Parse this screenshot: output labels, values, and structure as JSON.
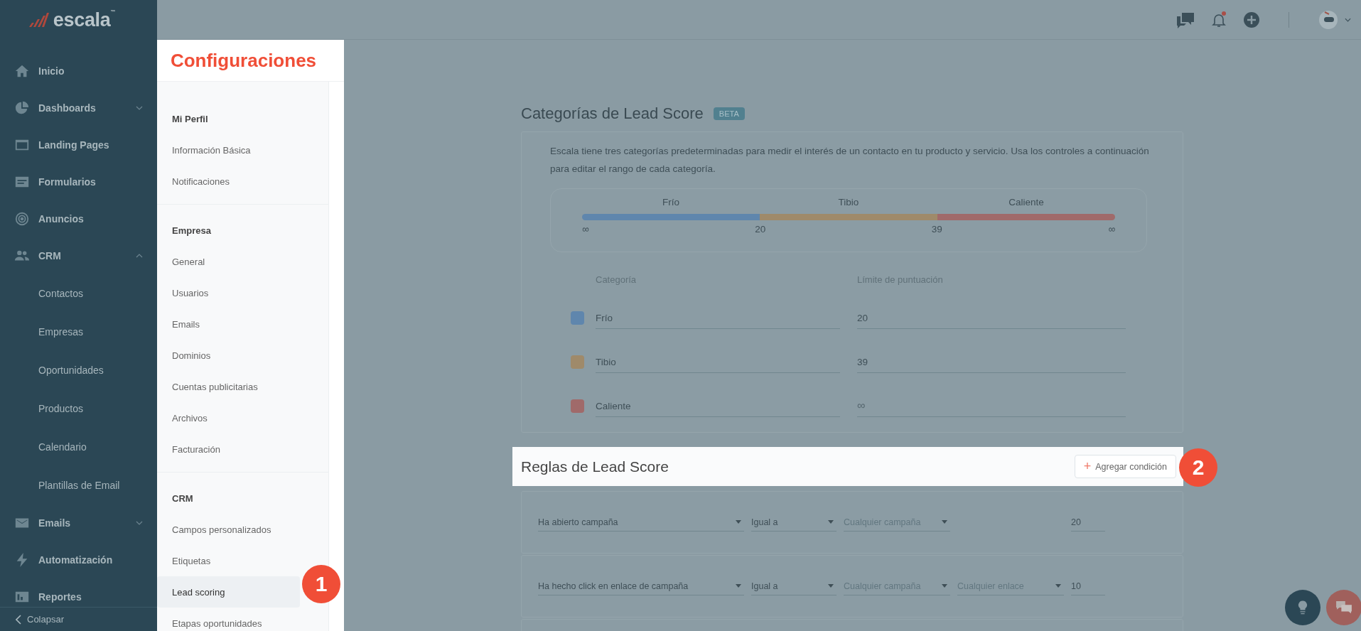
{
  "logo": {
    "text": "escala",
    "mark": "™"
  },
  "sidebar": {
    "items": [
      {
        "label": "Inicio",
        "kind": "section"
      },
      {
        "label": "Dashboards",
        "kind": "section",
        "expanded": false
      },
      {
        "label": "Landing Pages",
        "kind": "section"
      },
      {
        "label": "Formularios",
        "kind": "section"
      },
      {
        "label": "Anuncios",
        "kind": "section"
      },
      {
        "label": "CRM",
        "kind": "section",
        "expanded": true
      },
      {
        "label": "Contactos",
        "kind": "subitem"
      },
      {
        "label": "Empresas",
        "kind": "subitem"
      },
      {
        "label": "Oportunidades",
        "kind": "subitem"
      },
      {
        "label": "Productos",
        "kind": "subitem"
      },
      {
        "label": "Calendario",
        "kind": "subitem"
      },
      {
        "label": "Plantillas de Email",
        "kind": "subitem"
      },
      {
        "label": "Emails",
        "kind": "section",
        "expanded": false
      },
      {
        "label": "Automatización",
        "kind": "section"
      },
      {
        "label": "Reportes",
        "kind": "section"
      }
    ],
    "collapse": "Colapsar"
  },
  "topbar": {
    "notification_dot": true
  },
  "settings": {
    "title": "Configuraciones",
    "groups": [
      {
        "heading": "Mi Perfil",
        "items": [
          {
            "label": "Información Básica",
            "selected": false
          },
          {
            "label": "Notificaciones",
            "selected": false
          }
        ]
      },
      {
        "heading": "Empresa",
        "items": [
          {
            "label": "General",
            "selected": false
          },
          {
            "label": "Usuarios",
            "selected": false
          },
          {
            "label": "Emails",
            "selected": false
          },
          {
            "label": "Dominios",
            "selected": false
          },
          {
            "label": "Cuentas publicitarias",
            "selected": false
          },
          {
            "label": "Archivos",
            "selected": false
          },
          {
            "label": "Facturación",
            "selected": false
          }
        ]
      },
      {
        "heading": "CRM",
        "items": [
          {
            "label": "Campos personalizados",
            "selected": false
          },
          {
            "label": "Etiquetas",
            "selected": false
          },
          {
            "label": "Lead scoring",
            "selected": true
          },
          {
            "label": "Etapas oportunidades",
            "selected": false
          }
        ]
      }
    ]
  },
  "categories": {
    "title": "Categorías de Lead Score",
    "badge": "BETA",
    "description": "Escala tiene tres categorías predeterminadas para medir el interés de un contacto en tu producto y servicio. Usa los controles a continuación para editar el rango de cada categoría.",
    "scale": {
      "segments": [
        {
          "label": "Frío",
          "color": "#5f86ad"
        },
        {
          "label": "Tibio",
          "color": "#9f8a6a"
        },
        {
          "label": "Caliente",
          "color": "#a06a6a"
        }
      ],
      "ticks": [
        "∞",
        "20",
        "39",
        "∞"
      ]
    },
    "columns": [
      "Categoría",
      "Límite de puntuación"
    ],
    "rows": [
      {
        "color": "#5f86ad",
        "name": "Frío",
        "limit": {
          "value": "20"
        }
      },
      {
        "color": "#9f8a6a",
        "name": "Tibio",
        "limit": {
          "value": "39"
        }
      },
      {
        "color": "#a06a6a",
        "name": "Caliente",
        "limit": {
          "placeholder": "∞"
        }
      }
    ]
  },
  "rules": {
    "title": "Reglas de Lead Score",
    "add_button": "Agregar condición",
    "add_icon": "+",
    "rows": [
      {
        "condition": "Ha abierto campaña",
        "operator": "Igual a",
        "campaign": "Cualquier campaña",
        "points": "20"
      },
      {
        "condition": "Ha hecho click en enlace de campaña",
        "operator": "Igual a",
        "campaign": "Cualquier campaña",
        "link": "Cualquier enlace",
        "points": "10"
      }
    ]
  },
  "steps": [
    "1",
    "2"
  ]
}
